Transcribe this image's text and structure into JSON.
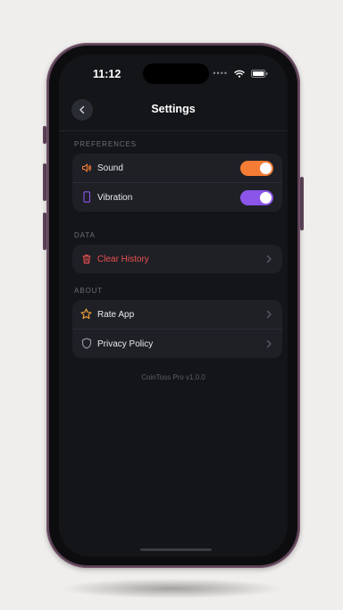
{
  "status_bar": {
    "time": "11:12",
    "signal": "••••"
  },
  "nav": {
    "title": "Settings"
  },
  "sections": {
    "preferences": {
      "label": "PREFERENCES",
      "sound": {
        "label": "Sound",
        "icon": "speaker-icon",
        "enabled": true,
        "color": "#f47c34"
      },
      "vibration": {
        "label": "Vibration",
        "icon": "phone-icon",
        "enabled": true,
        "color": "#8b55e9"
      }
    },
    "data": {
      "label": "DATA",
      "clear_history": {
        "label": "Clear History",
        "icon": "trash-icon",
        "color": "#ea4f4f"
      }
    },
    "about": {
      "label": "ABOUT",
      "rate_app": {
        "label": "Rate App",
        "icon": "star-icon"
      },
      "privacy_policy": {
        "label": "Privacy Policy",
        "icon": "shield-icon"
      }
    }
  },
  "footer": {
    "version": "CoinToss Pro v1.0.0"
  }
}
